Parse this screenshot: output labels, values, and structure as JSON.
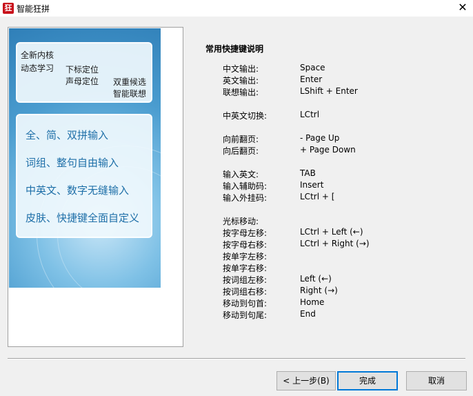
{
  "window": {
    "title": "智能狂拼",
    "icon_glyph": "狂",
    "close_glyph": "✕"
  },
  "banner": {
    "lines": [
      "全新内核",
      "动态学习",
      "下标定位",
      "声母定位",
      "双重候选",
      "智能联想"
    ],
    "features": [
      "全、简、双拼输入",
      "词组、整句自由输入",
      "中英文、数字无缝输入",
      "皮肤、快捷键全面自定义"
    ]
  },
  "shortcuts": {
    "title": "常用快捷键说明",
    "items": [
      {
        "label": "中文输出:",
        "key": "Space"
      },
      {
        "label": "英文输出:",
        "key": "Enter"
      },
      {
        "label": "联想输出:",
        "key": "LShift + Enter"
      },
      {
        "label": "中英文切换:",
        "key": "LCtrl"
      },
      {
        "label": "向前翻页:",
        "key": " -  Page Up"
      },
      {
        "label": "向后翻页:",
        "key": " +  Page Down"
      },
      {
        "label": "输入英文:",
        "key": "TAB"
      },
      {
        "label": "输入辅助码:",
        "key": "Insert"
      },
      {
        "label": "输入外挂码:",
        "key": "LCtrl +  ["
      },
      {
        "label": "光标移动:",
        "key": ""
      },
      {
        "label": "按字母左移:",
        "key": "LCtrl + Left  (←)"
      },
      {
        "label": "按字母右移:",
        "key": "LCtrl + Right  (→)"
      },
      {
        "label": "按单字左移:",
        "key": ""
      },
      {
        "label": "按单字右移:",
        "key": ""
      },
      {
        "label": "按词组左移:",
        "key": "Left  (←)"
      },
      {
        "label": "按词组右移:",
        "key": "Right  (→)"
      },
      {
        "label": "移动到句首:",
        "key": "Home"
      },
      {
        "label": "移动到句尾:",
        "key": "End"
      }
    ]
  },
  "buttons": {
    "back": "< 上一步(B)",
    "finish": "完成",
    "cancel": "取消"
  },
  "colors": {
    "feature_text": "#1e6fa8",
    "default_button_border": "#0078d7"
  }
}
